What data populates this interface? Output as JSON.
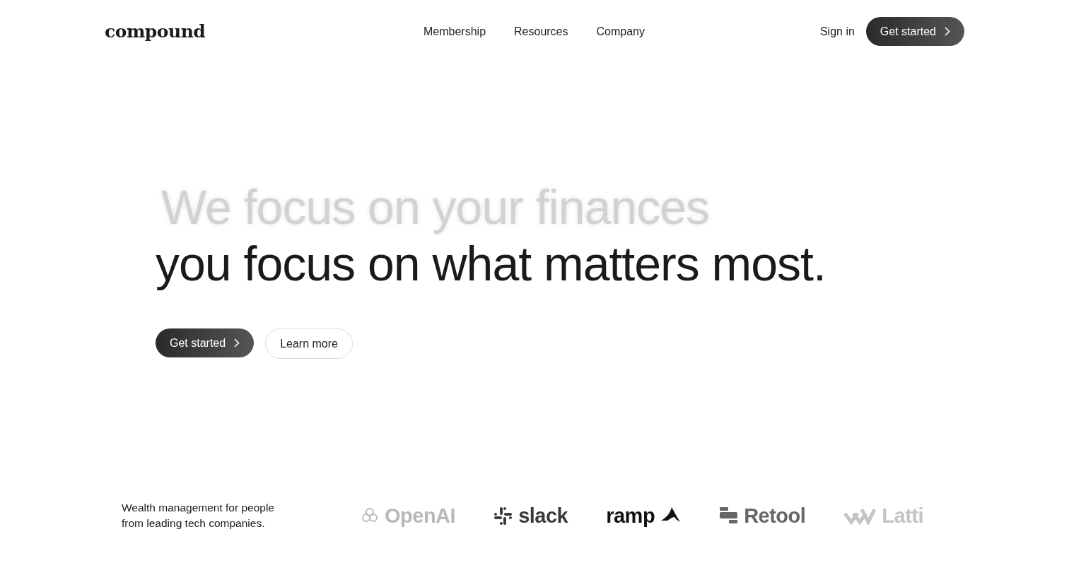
{
  "header": {
    "logo": "compound",
    "nav": [
      "Membership",
      "Resources",
      "Company"
    ],
    "sign_in": "Sign in",
    "cta": "Get started"
  },
  "hero": {
    "lines": [
      {
        "text": "We focus on your finances",
        "blurred": true
      },
      {
        "text": "you focus on what matters most.",
        "blurred": false
      }
    ],
    "buttons": [
      {
        "label": "Get started",
        "kind": "primary"
      },
      {
        "label": "Learn more",
        "kind": "secondary"
      }
    ]
  },
  "footer": {
    "tagline": "Wealth management for people from leading tech companies.",
    "logos": [
      {
        "name": "OpenAI",
        "kind": "knot",
        "color": "#b8b8b8"
      },
      {
        "name": "slack",
        "kind": "hash",
        "color": "#3a3a3a"
      },
      {
        "name": "ramp",
        "kind": "swoosh",
        "color": "#111111"
      },
      {
        "name": "Retool",
        "kind": "bars",
        "color": "#666666"
      },
      {
        "name": "Latti",
        "kind": "chevrons",
        "color": "#c4c4c4"
      }
    ]
  }
}
